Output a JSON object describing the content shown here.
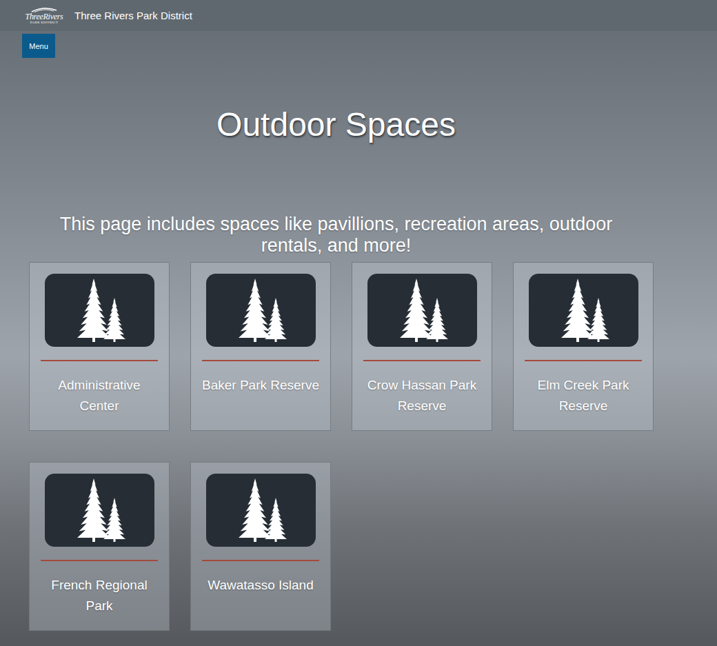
{
  "header": {
    "logo": {
      "name": "ThreeRivers",
      "sub": "PARK DISTRICT"
    },
    "title": "Three Rivers Park District"
  },
  "menu_button": {
    "label": "Menu"
  },
  "page": {
    "title": "Outdoor Spaces",
    "subtitle": "This page includes spaces like pavillions, recreation areas, outdoor rentals, and more!"
  },
  "cards": [
    {
      "label": "Administrative Center"
    },
    {
      "label": "Baker Park Reserve"
    },
    {
      "label": "Crow Hassan Park Reserve"
    },
    {
      "label": "Elm Creek Park Reserve"
    },
    {
      "label": "French Regional Park"
    },
    {
      "label": "Wawatasso Island"
    }
  ]
}
